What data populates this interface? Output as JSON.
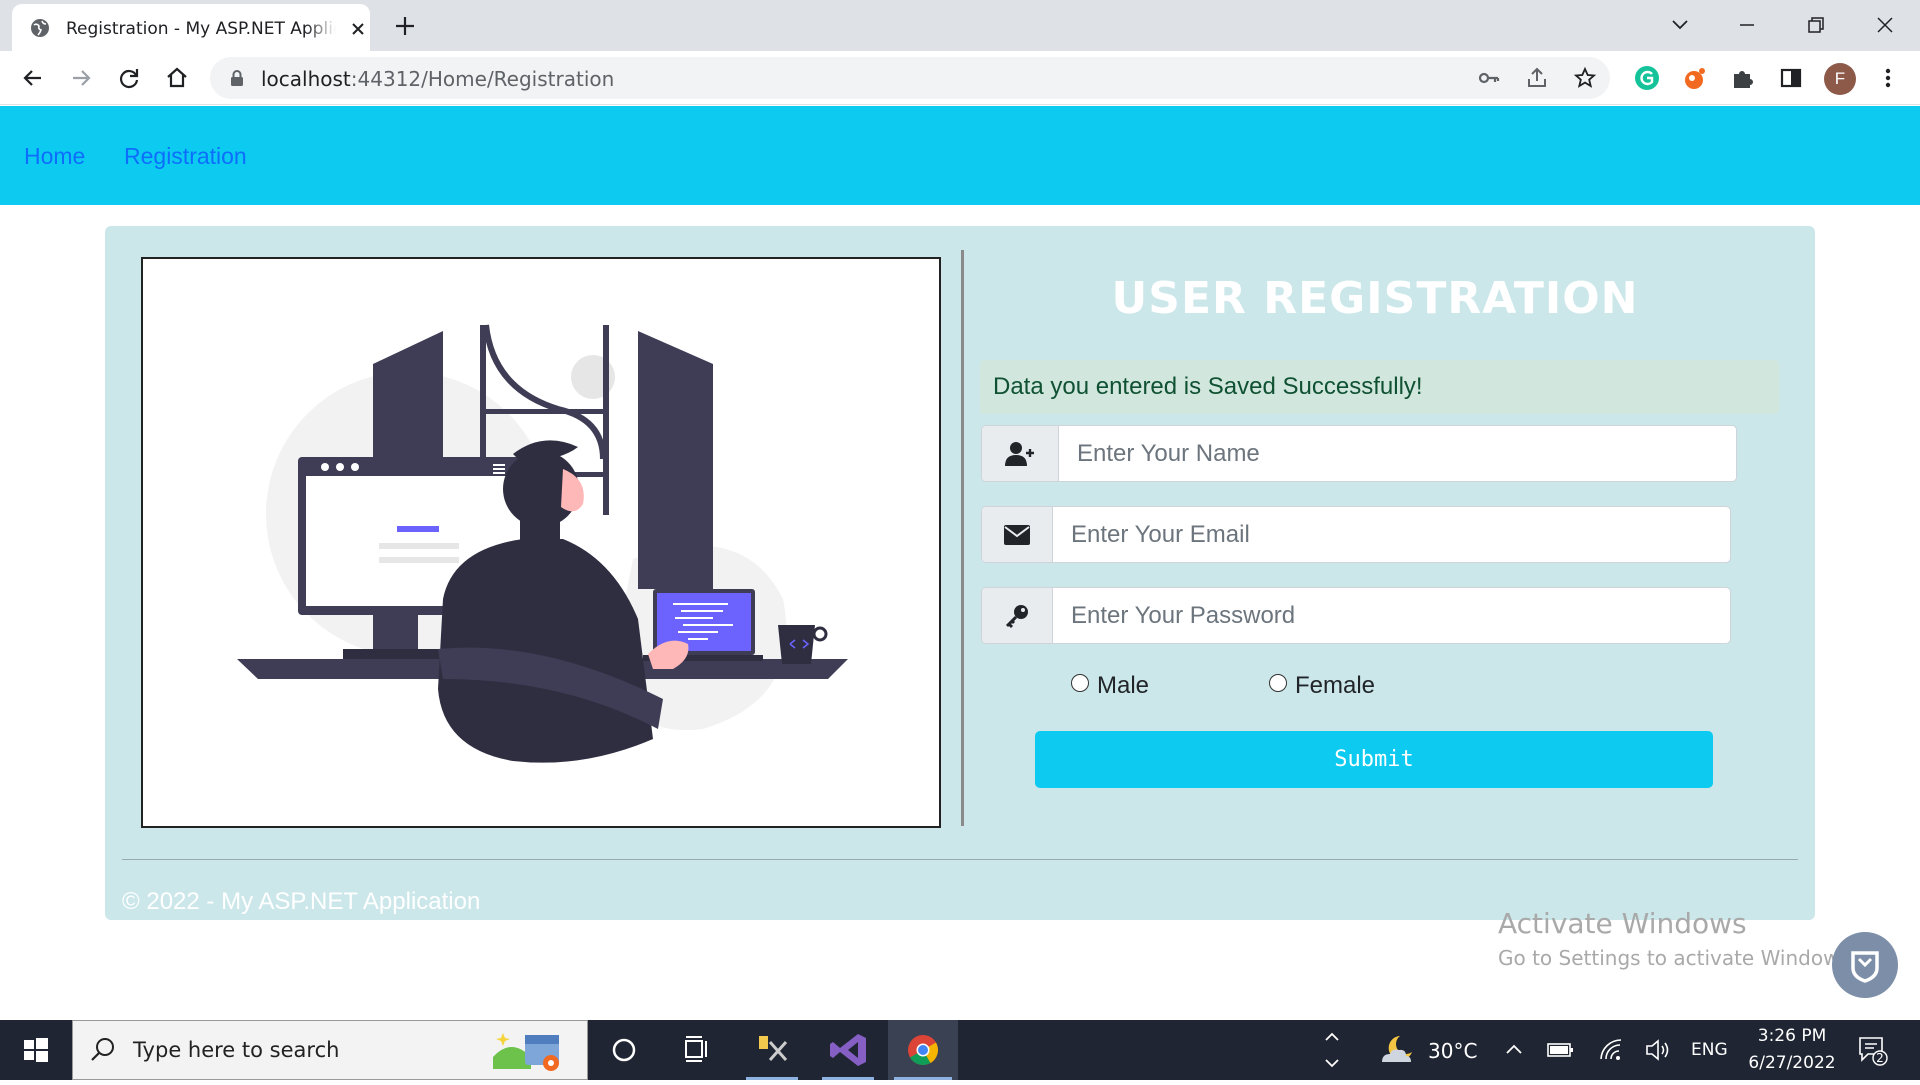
{
  "browser": {
    "tab_title": "Registration - My ASP.NET Application",
    "url_host": "localhost",
    "url_path": ":44312/Home/Registration",
    "profile_initial": "F"
  },
  "navbar": {
    "links": [
      {
        "label": "Home"
      },
      {
        "label": "Registration"
      }
    ],
    "bg_color": "#0dcaf0",
    "link_color": "#0d6efd"
  },
  "form": {
    "title": "USER REGISTRATION",
    "alert": "Data you entered is Saved Successfully!",
    "name_placeholder": "Enter Your Name",
    "email_placeholder": "Enter Your Email",
    "password_placeholder": "Enter Your Password",
    "gender_options": [
      {
        "label": "Male"
      },
      {
        "label": "Female"
      }
    ],
    "submit_label": "Submit"
  },
  "footer": {
    "text": "© 2022 - My ASP.NET Application"
  },
  "watermark": {
    "title": "Activate Windows",
    "subtitle": "Go to Settings to activate Windows."
  },
  "taskbar": {
    "search_placeholder": "Type here to search",
    "temperature": "30°C",
    "language": "ENG",
    "time": "3:26 PM",
    "date": "6/27/2022",
    "notification_count": "2"
  }
}
